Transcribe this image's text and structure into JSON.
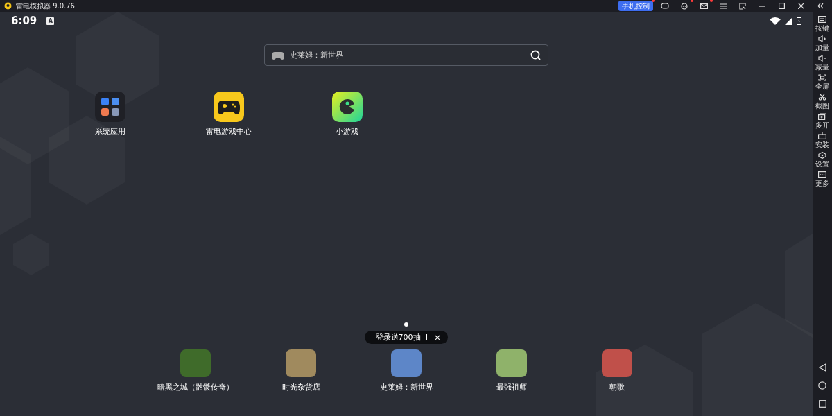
{
  "title_bar": {
    "app_name": "雷电模拟器 9.0.76",
    "phone_control": {
      "label": "手机控制",
      "notification": true
    },
    "tools": [
      {
        "kind": "gamepad",
        "notification": false
      },
      {
        "kind": "robot",
        "notification": true
      },
      {
        "kind": "mail",
        "notification": true
      },
      {
        "kind": "menu",
        "notification": false
      },
      {
        "kind": "screen",
        "notification": false
      }
    ]
  },
  "status_bar": {
    "time": "6:09",
    "notice": "A"
  },
  "search": {
    "placeholder": "史莱姆：新世界"
  },
  "desktop_apps": [
    {
      "label": "系统应用",
      "kind": "folder"
    },
    {
      "label": "雷电游戏中心",
      "kind": "game-center"
    },
    {
      "label": "小游戏",
      "kind": "mini-game"
    }
  ],
  "page_dots": [
    {
      "selected": true
    }
  ],
  "promo": {
    "text": "登录送700抽",
    "close": "×"
  },
  "dock": [
    {
      "label": "暗黑之城（骷髅传奇）",
      "color": "#3f6b2a"
    },
    {
      "label": "时光杂货店",
      "color": "#a08a5e"
    },
    {
      "label": "史莱姆：新世界",
      "color": "#5d86c8"
    },
    {
      "label": "最强祖师",
      "color": "#8fb26a"
    },
    {
      "label": "朝歌",
      "color": "#c0504a"
    }
  ],
  "side_toolbar": [
    {
      "label": "按键",
      "kind": "keyboard"
    },
    {
      "label": "加量",
      "kind": "volume-up"
    },
    {
      "label": "减量",
      "kind": "volume-down"
    },
    {
      "label": "全屏",
      "kind": "fullscreen"
    },
    {
      "label": "截图",
      "kind": "scissors"
    },
    {
      "label": "多开",
      "kind": "multi"
    },
    {
      "label": "安装",
      "kind": "apk"
    },
    {
      "label": "设置",
      "kind": "settings"
    },
    {
      "label": "更多",
      "kind": "more"
    }
  ],
  "nav_buttons": [
    {
      "kind": "back"
    },
    {
      "kind": "home"
    },
    {
      "kind": "recent"
    }
  ]
}
